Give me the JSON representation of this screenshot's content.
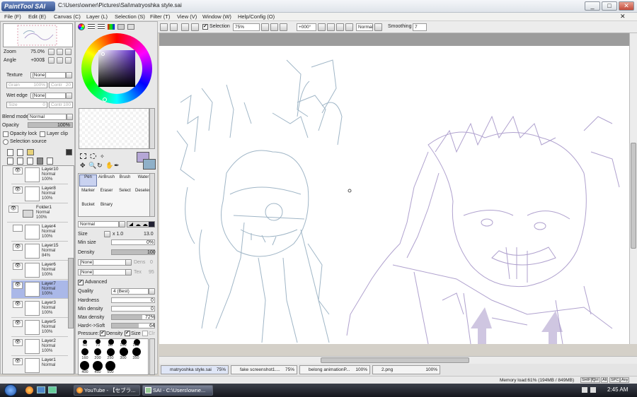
{
  "window": {
    "logo": "PaintTool SAI",
    "title": "C:\\Users\\owner\\Pictures\\Sai\\matryoshka style.sai",
    "controls": [
      "minimize-icon",
      "maximize-icon",
      "close-icon"
    ]
  },
  "menu": [
    "File (F)",
    "Edit (E)",
    "Canvas (C)",
    "Layer (L)",
    "Selection (S)",
    "Filter (T)",
    "View (V)",
    "Window (W)",
    "Help/Config (O)"
  ],
  "navigator": {
    "zoom_label": "Zoom",
    "zoom_value": "75.0%",
    "angle_label": "Angle",
    "angle_value": "+000$"
  },
  "layer_props": {
    "texture_label": "Texture",
    "texture_value": "[None]",
    "grain_label": "Grain",
    "grain_value": "100%",
    "contr_label": "Contr",
    "contr_value": "20",
    "wet_edge_label": "Wet edge",
    "wet_edge_value": "[None]",
    "size_label": "Size",
    "size_value": "0",
    "contr2_value": "100",
    "blend_mode_label": "Blend mode",
    "blend_mode_value": "Normal",
    "opacity_label": "Opacity",
    "opacity_value": "100%",
    "opacity_lock": "Opacity lock",
    "layer_clip": "Layer clip",
    "selection_source": "Selection source"
  },
  "layers": [
    {
      "name": "Layer10",
      "mode": "Normal",
      "opacity": "100%"
    },
    {
      "name": "Layer8",
      "mode": "Normal",
      "opacity": "100%"
    },
    {
      "name": "Folder1",
      "mode": "Normal",
      "opacity": "100%"
    },
    {
      "name": "Layer4",
      "mode": "Normal",
      "opacity": "100%"
    },
    {
      "name": "Layer15",
      "mode": "Normal",
      "opacity": "84%"
    },
    {
      "name": "Layer6",
      "mode": "Normal",
      "opacity": "100%"
    },
    {
      "name": "Layer7",
      "mode": "Normal",
      "opacity": "100%"
    },
    {
      "name": "Layer3",
      "mode": "Normal",
      "opacity": "100%"
    },
    {
      "name": "Layer5",
      "mode": "Normal",
      "opacity": "100%"
    },
    {
      "name": "Layer2",
      "mode": "Normal",
      "opacity": "100%"
    },
    {
      "name": "Layer1",
      "mode": "Normal",
      "opacity": ""
    }
  ],
  "tools": [
    {
      "label": "Pen"
    },
    {
      "label": "AirBrush"
    },
    {
      "label": "Brush"
    },
    {
      "label": "Water"
    },
    {
      "label": "Marker"
    },
    {
      "label": "Eraser"
    },
    {
      "label": "Select"
    },
    {
      "label": "Deselect"
    },
    {
      "label": "Bucket"
    },
    {
      "label": "Binary"
    }
  ],
  "brush": {
    "mode": "Normal",
    "size_label": "Size",
    "size_mult": "x 1.0",
    "size_value": "13.0",
    "min_size_label": "Min size",
    "min_size_value": "0%",
    "density_label": "Density",
    "density_value": "100",
    "shape1": "[None]",
    "shape2": "[None]",
    "dens_label": "Dens",
    "dens_value": "0",
    "tex_label": "Tex",
    "tex_value": "95",
    "advanced_label": "Advanced",
    "quality_label": "Quality",
    "quality_value": "4 (Best)",
    "hardness_label": "Hardness",
    "hardness_value": "0",
    "min_density_label": "Min density",
    "min_density_value": "0",
    "max_density_label": "Max density",
    "max_density_value": "72%",
    "hard_soft_label": "Hard<->Soft",
    "hard_soft_value": "64",
    "pressure_label": "Pressure:",
    "pressure_density": "Density",
    "pressure_size": "Size",
    "pressure_clr": "Clr",
    "dot_sizes": [
      "60",
      "70",
      "80",
      "100",
      "120",
      "160",
      "200",
      "250",
      "300",
      "350",
      "400",
      "450",
      "500"
    ]
  },
  "toolbar": {
    "selection_label": "Selection",
    "zoom_value": "75%",
    "angle_value": "+000°",
    "mode_value": "Normal",
    "smoothing_label": "Smoothing",
    "smoothing_value": "7"
  },
  "tabs": [
    {
      "name": "matryoshka style.sai",
      "pct": "75%"
    },
    {
      "name": "fake screenshot1....",
      "pct": "75%"
    },
    {
      "name": "belong animationP...",
      "pct": "100%"
    },
    {
      "name": "2.png",
      "pct": "100%"
    }
  ],
  "status": {
    "memory": "Memory load:61% (194MB / 849MB)",
    "keys": [
      "SHIFT",
      "Ctrl",
      "Alt",
      "SPC",
      "Any"
    ]
  },
  "taskbar": {
    "items": [
      {
        "label": "YouTube - 【セブラ..."
      },
      {
        "label": "SAI - C:\\Users\\owne..."
      }
    ],
    "clock": "2:45 AM"
  },
  "colors": {
    "sketch_blue": "#8fa9bd",
    "sketch_purple": "#a797c9",
    "primary_swatch": "#b5a7d6",
    "secondary_swatch": "#8fb0c8"
  }
}
